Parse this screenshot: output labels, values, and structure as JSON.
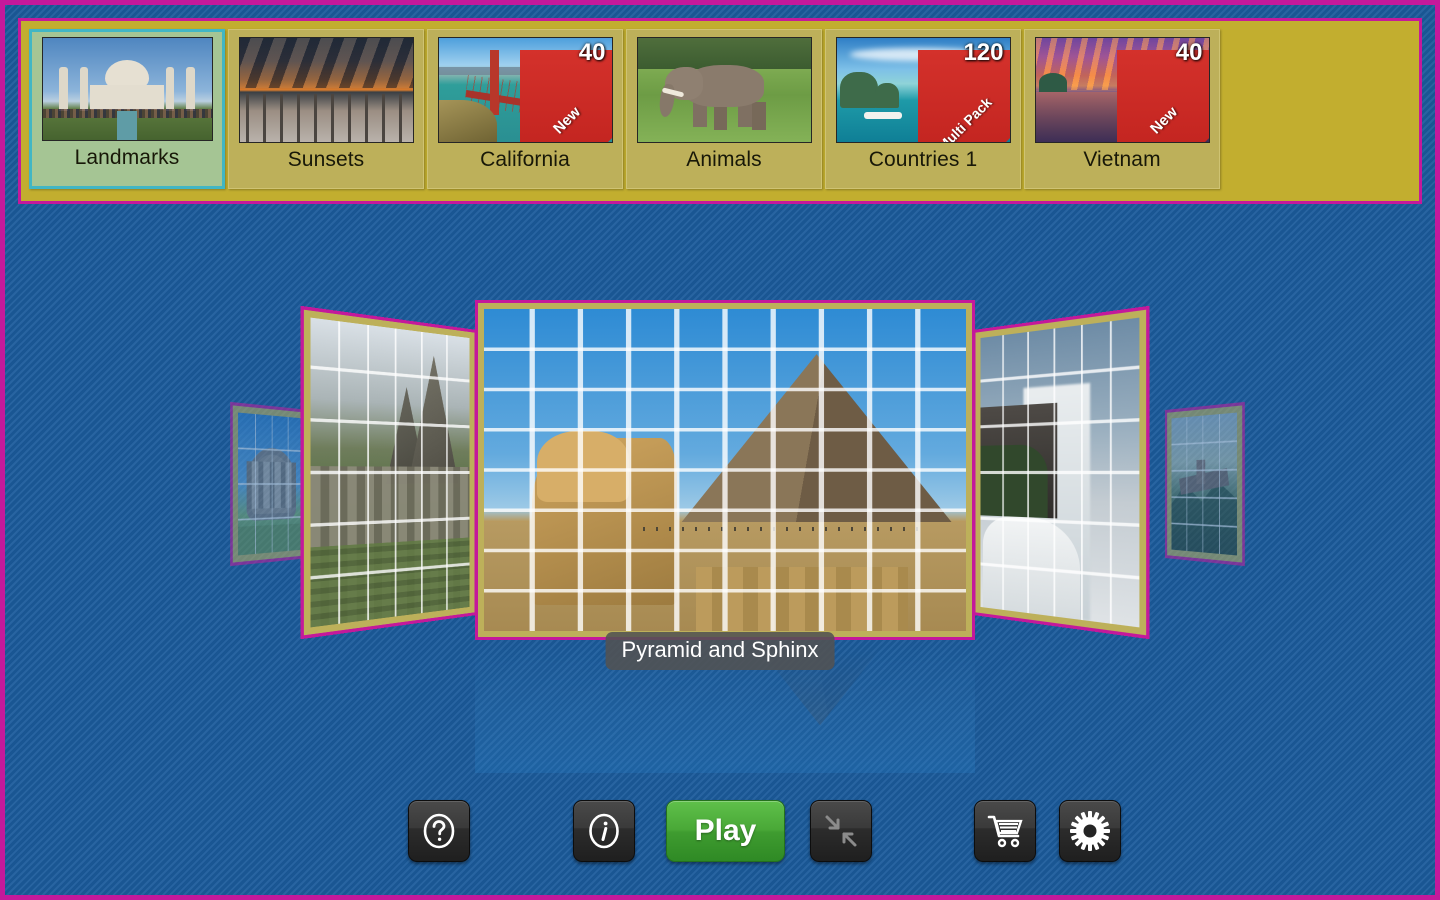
{
  "theme": {
    "background_color": "#1b5b9c",
    "border_color": "#c4199b",
    "panel_color": "#c2ae2f",
    "tile_color": "#bdb05a",
    "selected_tile_color": "#a5c594",
    "selected_tile_border": "#41b6c4",
    "ribbon_color": "#cc2a22",
    "play_button_color": "#49a837"
  },
  "category_bar": {
    "items": [
      {
        "label": "Landmarks",
        "selected": true,
        "count": "",
        "ribbon": "",
        "thumb": "taj-mahal-thumb"
      },
      {
        "label": "Sunsets",
        "selected": false,
        "count": "",
        "ribbon": "",
        "thumb": "sunset-thumb"
      },
      {
        "label": "California",
        "selected": false,
        "count": "40",
        "ribbon": "New",
        "thumb": "golden-gate-thumb"
      },
      {
        "label": "Animals",
        "selected": false,
        "count": "",
        "ribbon": "",
        "thumb": "elephant-thumb"
      },
      {
        "label": "Countries 1",
        "selected": false,
        "count": "120",
        "ribbon": "Multi Pack",
        "thumb": "halong-bay-thumb"
      },
      {
        "label": "Vietnam",
        "selected": false,
        "count": "40",
        "ribbon": "New",
        "thumb": "vietnam-temple-thumb"
      }
    ]
  },
  "carousel": {
    "selected_title": "Pyramid and Sphinx",
    "slides": [
      {
        "position": "far-left",
        "name": "colosseum-puzzle"
      },
      {
        "position": "left",
        "name": "machu-picchu-puzzle"
      },
      {
        "position": "center",
        "name": "pyramid-and-sphinx-puzzle"
      },
      {
        "position": "right",
        "name": "waterfall-puzzle"
      },
      {
        "position": "far-right",
        "name": "great-wall-puzzle"
      }
    ]
  },
  "toolbar": {
    "help_label": "?",
    "help_name": "Help",
    "info_label": "i",
    "info_name": "Info",
    "play_label": "Play",
    "collapse_name": "Collapse",
    "shop_name": "Shop",
    "settings_name": "Settings"
  }
}
